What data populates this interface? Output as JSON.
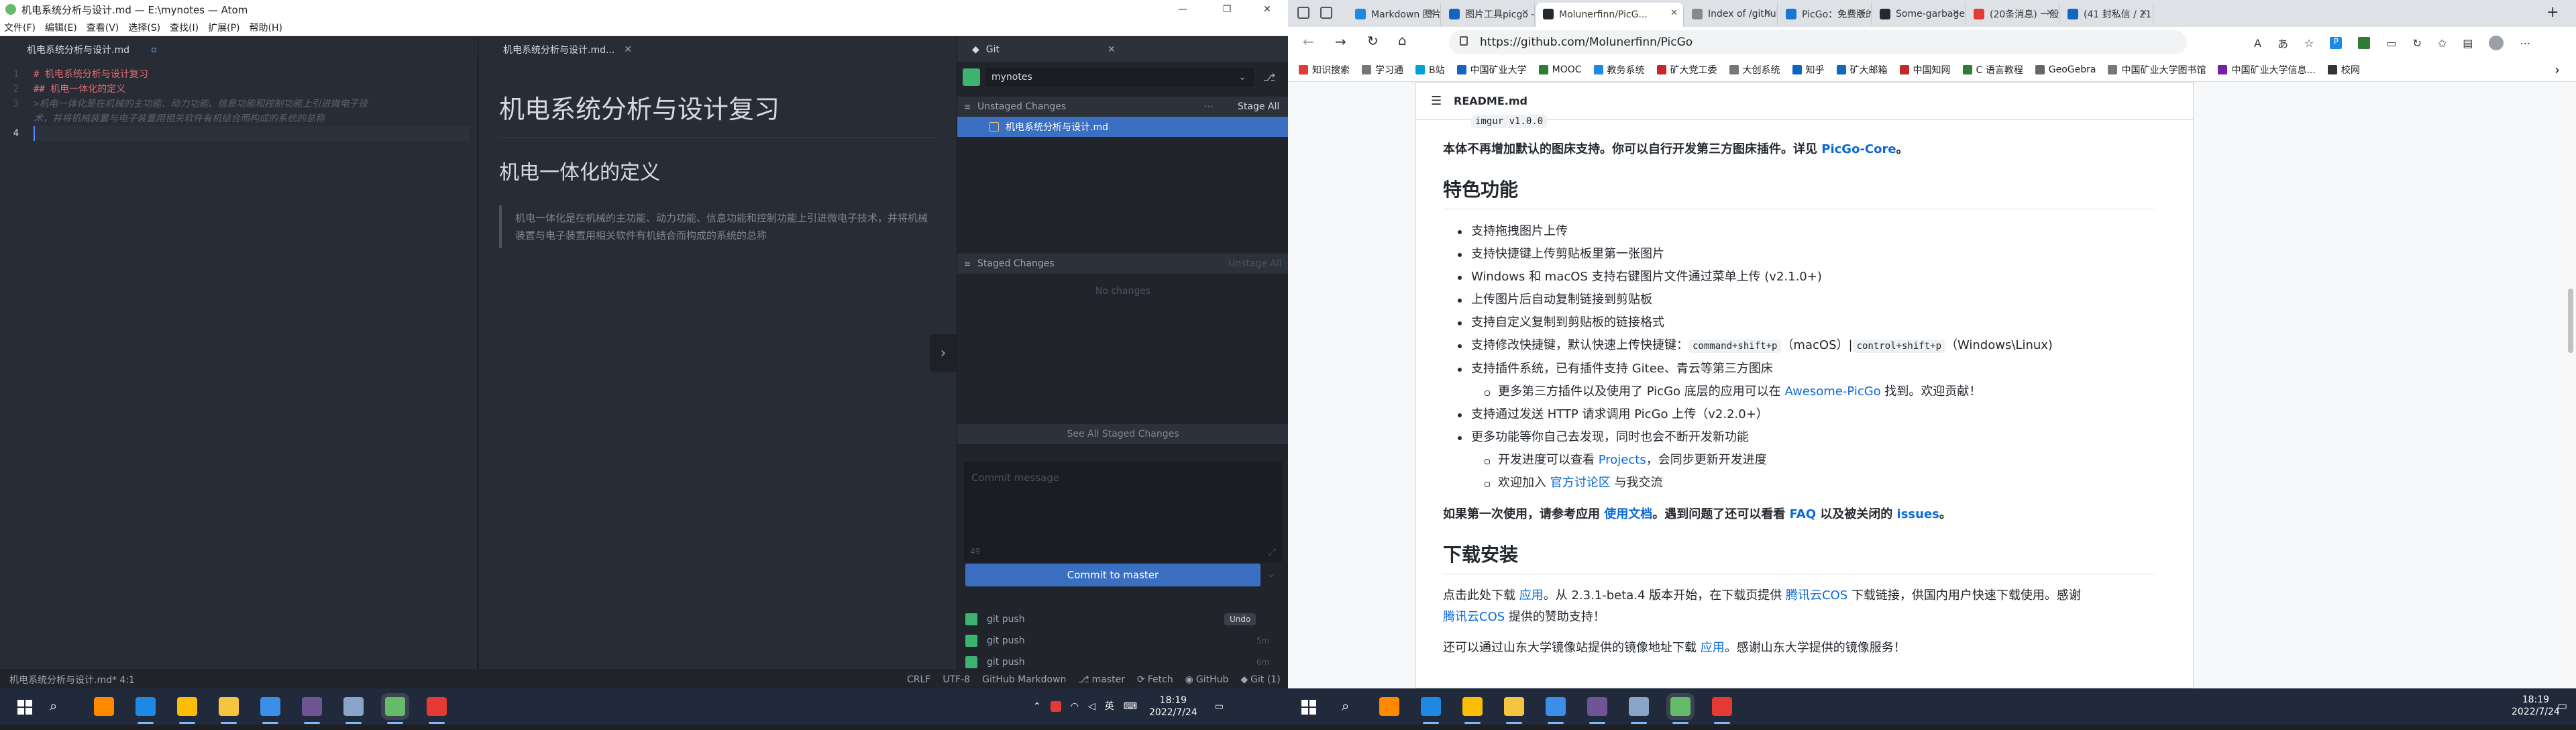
{
  "atom": {
    "window_title": "机电系统分析与设计.md — E:\\mynotes — Atom",
    "menu": [
      "文件(F)",
      "编辑(E)",
      "查看(V)",
      "选择(S)",
      "查找(I)",
      "扩展(P)",
      "帮助(H)"
    ],
    "tabs": {
      "editor": "机电系统分析与设计.md",
      "preview": "机电系统分析与设计.md..."
    },
    "editor": {
      "line_numbers": [
        "1",
        "2",
        "3",
        "",
        "4"
      ],
      "lines": [
        "# 机电系统分析与设计复习",
        "## 机电一体化的定义",
        ">机电一体化是在机械的主功能、动力功能、信息功能和控制功能上引进微电子技",
        "术，并将机械装置与电子装置用相关软件有机结合而构成的系统的总称",
        ""
      ]
    },
    "preview": {
      "h1": "机电系统分析与设计复习",
      "h2": "机电一体化的定义",
      "quote": "机电一体化是在机械的主功能、动力功能、信息功能和控制功能上引进微电子技术，并将机械装置与电子装置用相关软件有机结合而构成的系统的总称"
    },
    "git": {
      "tab_label": "Git",
      "repo": "mynotes",
      "unstaged_title": "Unstaged Changes",
      "stage_all": "Stage All",
      "unstaged_files": [
        "机电系统分析与设计.md"
      ],
      "staged_title": "Staged Changes",
      "unstage_all": "Unstage All",
      "no_changes": "No changes",
      "see_all": "See All Staged Changes",
      "commit_placeholder": "Commit message",
      "commit_counter": "49",
      "commit_button": "Commit to master",
      "log": [
        {
          "msg": "git push",
          "action": "Undo"
        },
        {
          "msg": "git push",
          "action": "5m"
        },
        {
          "msg": "git push",
          "action": "6m"
        }
      ]
    },
    "status": {
      "left": "机电系统分析与设计.md*  4:1",
      "items": [
        "CRLF",
        "UTF-8",
        "GitHub Markdown",
        "master",
        "Fetch",
        "GitHub",
        "Git (1)"
      ]
    }
  },
  "chrome": {
    "tabs": [
      {
        "title": "Markdown 图片的...",
        "color": "#1e88e5"
      },
      {
        "title": "图片工具picgo - ...",
        "color": "#1565c0"
      },
      {
        "title": "Molunerfinn/PicG...",
        "color": "#24292f",
        "active": true
      },
      {
        "title": "Index of /github-...",
        "color": "#888888"
      },
      {
        "title": "PicGo：免费版的...",
        "color": "#1976d2"
      },
      {
        "title": "Some-garbage-H...",
        "color": "#24292f"
      },
      {
        "title": "(20条消息) 一般ど...",
        "color": "#e53935"
      },
      {
        "title": "(41 封私信 / 21 ...",
        "color": "#1565c0"
      }
    ],
    "url": "https://github.com/Molunerfinn/PicGo",
    "bookmarks": [
      {
        "label": "知识搜索",
        "color": "#e53935"
      },
      {
        "label": "学习通",
        "color": "#777777"
      },
      {
        "label": "B站",
        "color": "#00a1d6"
      },
      {
        "label": "中国矿业大学",
        "color": "#1565c0"
      },
      {
        "label": "MOOC",
        "color": "#2e7d32"
      },
      {
        "label": "教务系统",
        "color": "#1e88e5"
      },
      {
        "label": "矿大党工委",
        "color": "#c62828"
      },
      {
        "label": "大创系统",
        "color": "#777777"
      },
      {
        "label": "知乎",
        "color": "#0a66c2"
      },
      {
        "label": "矿大邮箱",
        "color": "#1565c0"
      },
      {
        "label": "中国知网",
        "color": "#c62828"
      },
      {
        "label": "C 语言教程",
        "color": "#2e7d32"
      },
      {
        "label": "GeoGebra",
        "color": "#666666"
      },
      {
        "label": "中国矿业大学图书馆",
        "color": "#777777"
      },
      {
        "label": "中国矿业大学信息...",
        "color": "#7b1fa2"
      },
      {
        "label": "校网",
        "color": "#333333"
      }
    ],
    "readme": {
      "file": "README.md",
      "top_line": "imgur v1.0.0",
      "intro": {
        "t1": "本体不再增加默认的图床支持。你可以自行开发第三方图床插件。详见 ",
        "link": "PicGo-Core",
        "t2": "。"
      },
      "features_title": "特色功能",
      "features": [
        {
          "text": "支持拖拽图片上传"
        },
        {
          "text": "支持快捷键上传剪贴板里第一张图片"
        },
        {
          "text": "Windows 和 macOS 支持右键图片文件通过菜单上传 (v2.1.0+)"
        },
        {
          "text": "上传图片后自动复制链接到剪贴板"
        },
        {
          "text": "支持自定义复制到剪贴板的链接格式"
        },
        {
          "text": "支持修改快捷键，默认快速上传快捷键：",
          "code1": "command+shift+p",
          "mid": "（macOS）|",
          "code2": "control+shift+p",
          "tail": "（Windows\\Linux)"
        },
        {
          "text": "支持插件系统，已有插件支持 Gitee、青云等第三方图床"
        },
        {
          "text": "更多第三方插件以及使用了 PicGo 底层的应用可以在 ",
          "link": "Awesome-PicGo",
          "tail": " 找到。欢迎贡献！",
          "sub": true
        },
        {
          "text": "支持通过发送 HTTP 请求调用 PicGo 上传（v2.2.0+）"
        },
        {
          "text": "更多功能等你自己去发现，同时也会不断开发新功能"
        },
        {
          "text": "开发进度可以查看 ",
          "link": "Projects",
          "tail": "，会同步更新开发进度",
          "sub": true
        },
        {
          "text": "欢迎加入 ",
          "link": "官方讨论区",
          "tail": " 与我交流",
          "sub": true
        }
      ],
      "first_use": {
        "t1": "如果第一次使用，请参考应用 ",
        "l1": "使用文档",
        "t2": "。遇到问题了还可以看看 ",
        "l2": "FAQ",
        "t3": " 以及被关闭的 ",
        "l3": "issues",
        "t4": "。"
      },
      "download_title": "下载安装",
      "download_p1": {
        "t1": "点击此处下载 ",
        "l1": "应用",
        "t2": "。从 2.3.1-beta.4 版本开始，在下载页提供 ",
        "l2": "腾讯云COS",
        "t3": " 下载链接，供国内用户快速下载使用。感谢",
        "l3": "腾讯云COS",
        "t4": " 提供的赞助支持！"
      },
      "download_p2": {
        "t1": "还可以通过山东大学镜像站提供的镜像地址下载 ",
        "l1": "应用",
        "t2": "。感谢山东大学提供的镜像服务！"
      }
    }
  },
  "taskbar": {
    "left_tray": {
      "lang": "英",
      "time": "18:19",
      "date": "2022/7/24"
    },
    "right_tray": {
      "time": "18:19",
      "date": "2022/7/24"
    },
    "apps": [
      {
        "name": "search-app",
        "color": "#ff8a00"
      },
      {
        "name": "edge",
        "color": "#1e88e5"
      },
      {
        "name": "chrome",
        "color": "#fbbc05"
      },
      {
        "name": "explorer",
        "color": "#f5c542"
      },
      {
        "name": "vscode",
        "color": "#3b8eea"
      },
      {
        "name": "github-desktop",
        "color": "#6e5494"
      },
      {
        "name": "typora",
        "color": "#8aa4c8"
      },
      {
        "name": "atom",
        "color": "#66bb6a"
      },
      {
        "name": "wps",
        "color": "#e53935"
      }
    ]
  }
}
